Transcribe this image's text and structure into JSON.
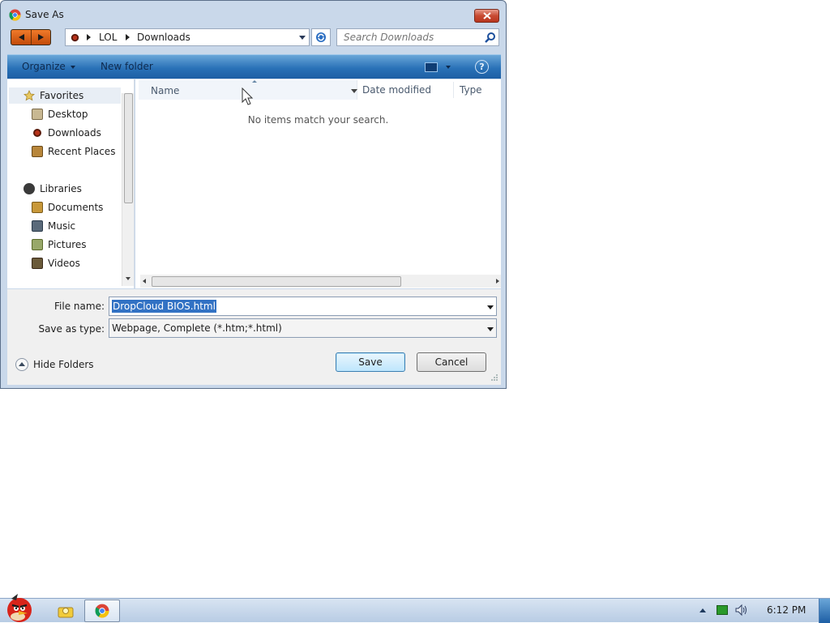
{
  "window": {
    "title": "Save As"
  },
  "address": {
    "crumbs": [
      "LOL",
      "Downloads"
    ]
  },
  "search": {
    "placeholder": "Search Downloads"
  },
  "toolbar": {
    "organize_label": "Organize",
    "new_folder_label": "New folder"
  },
  "nav": {
    "favorites_label": "Favorites",
    "favorites": [
      "Desktop",
      "Downloads",
      "Recent Places"
    ],
    "libraries_label": "Libraries",
    "libraries": [
      "Documents",
      "Music",
      "Pictures",
      "Videos"
    ]
  },
  "filelist": {
    "columns": [
      "Name",
      "Date modified",
      "Type"
    ],
    "empty_message": "No items match your search."
  },
  "form": {
    "filename_label": "File name:",
    "filename_value": "DropCloud BIOS.html",
    "savetype_label": "Save as type:",
    "savetype_value": "Webpage, Complete (*.htm;*.html)",
    "hide_folders_label": "Hide Folders",
    "save_label": "Save",
    "cancel_label": "Cancel"
  },
  "taskbar": {
    "clock": "6:12 PM"
  },
  "colors": {
    "toolbar_blue": "#2a72b8",
    "selection_blue": "#3272c4",
    "close_red": "#c84a32"
  }
}
